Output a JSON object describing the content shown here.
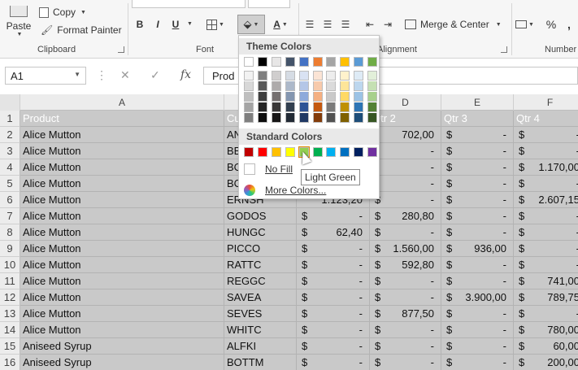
{
  "ribbon": {
    "clipboard": {
      "paste_label": "Paste",
      "copy_label": "Copy",
      "format_painter_label": "Format Painter",
      "group_label": "Clipboard"
    },
    "font": {
      "bold": "B",
      "italic": "I",
      "underline": "U",
      "group_label": "Font",
      "font_color_letter": "A"
    },
    "alignment": {
      "merge_label": "Merge & Center",
      "group_label": "Alignment"
    },
    "number": {
      "percent": "%",
      "comma": ",",
      "group_label": "Number"
    }
  },
  "formula_bar": {
    "name_box": "A1",
    "formula": "Prod",
    "fx": "fx"
  },
  "columns": [
    "A",
    "B",
    "C",
    "D",
    "E",
    "F"
  ],
  "rows": [
    {
      "n": "1",
      "a": "Product",
      "b": "Cu",
      "c": {
        "cur": "",
        "amt": ""
      },
      "d": "Qtr 2",
      "e": "Qtr 3",
      "f": "Qtr 4",
      "header": true
    },
    {
      "n": "2",
      "a": "Alice Mutton",
      "b": "AN",
      "c": {
        "cur": "",
        "amt": ""
      },
      "d": {
        "cur": "",
        "amt": "702,00"
      },
      "e": {
        "cur": "$",
        "amt": "-"
      },
      "f": {
        "cur": "$",
        "amt": "-"
      }
    },
    {
      "n": "3",
      "a": "Alice Mutton",
      "b": "BE",
      "c": {
        "cur": "",
        "amt": ""
      },
      "d": {
        "cur": "",
        "amt": "-"
      },
      "e": {
        "cur": "$",
        "amt": "-"
      },
      "f": {
        "cur": "$",
        "amt": "-"
      }
    },
    {
      "n": "4",
      "a": "Alice Mutton",
      "b": "BC",
      "c": {
        "cur": "",
        "amt": ""
      },
      "d": {
        "cur": "",
        "amt": "-"
      },
      "e": {
        "cur": "$",
        "amt": "-"
      },
      "f": {
        "cur": "$",
        "amt": "1.170,00"
      }
    },
    {
      "n": "5",
      "a": "Alice Mutton",
      "b": "BC",
      "c": {
        "cur": "",
        "amt": ""
      },
      "d": {
        "cur": "",
        "amt": "-"
      },
      "e": {
        "cur": "$",
        "amt": "-"
      },
      "f": {
        "cur": "$",
        "amt": "-"
      }
    },
    {
      "n": "6",
      "a": "Alice Mutton",
      "b": "ERNSH",
      "c": {
        "cur": "",
        "amt": "1.123,20"
      },
      "d": {
        "cur": "$",
        "amt": "-"
      },
      "e": {
        "cur": "$",
        "amt": "-"
      },
      "f": {
        "cur": "$",
        "amt": "2.607,15"
      }
    },
    {
      "n": "7",
      "a": "Alice Mutton",
      "b": "GODOS",
      "c": {
        "cur": "$",
        "amt": "-"
      },
      "d": {
        "cur": "$",
        "amt": "280,80"
      },
      "e": {
        "cur": "$",
        "amt": "-"
      },
      "f": {
        "cur": "$",
        "amt": "-"
      }
    },
    {
      "n": "8",
      "a": "Alice Mutton",
      "b": "HUNGC",
      "c": {
        "cur": "$",
        "amt": "62,40"
      },
      "d": {
        "cur": "$",
        "amt": "-"
      },
      "e": {
        "cur": "$",
        "amt": "-"
      },
      "f": {
        "cur": "$",
        "amt": "-"
      }
    },
    {
      "n": "9",
      "a": "Alice Mutton",
      "b": "PICCO",
      "c": {
        "cur": "$",
        "amt": "-"
      },
      "d": {
        "cur": "$",
        "amt": "1.560,00"
      },
      "e": {
        "cur": "$",
        "amt": "936,00"
      },
      "f": {
        "cur": "$",
        "amt": "-"
      }
    },
    {
      "n": "10",
      "a": "Alice Mutton",
      "b": "RATTC",
      "c": {
        "cur": "$",
        "amt": "-"
      },
      "d": {
        "cur": "$",
        "amt": "592,80"
      },
      "e": {
        "cur": "$",
        "amt": "-"
      },
      "f": {
        "cur": "$",
        "amt": "-"
      }
    },
    {
      "n": "11",
      "a": "Alice Mutton",
      "b": "REGGC",
      "c": {
        "cur": "$",
        "amt": "-"
      },
      "d": {
        "cur": "$",
        "amt": "-"
      },
      "e": {
        "cur": "$",
        "amt": "-"
      },
      "f": {
        "cur": "$",
        "amt": "741,00"
      }
    },
    {
      "n": "12",
      "a": "Alice Mutton",
      "b": "SAVEA",
      "c": {
        "cur": "$",
        "amt": "-"
      },
      "d": {
        "cur": "$",
        "amt": "-"
      },
      "e": {
        "cur": "$",
        "amt": "3.900,00"
      },
      "f": {
        "cur": "$",
        "amt": "789,75"
      }
    },
    {
      "n": "13",
      "a": "Alice Mutton",
      "b": "SEVES",
      "c": {
        "cur": "$",
        "amt": "-"
      },
      "d": {
        "cur": "$",
        "amt": "877,50"
      },
      "e": {
        "cur": "$",
        "amt": "-"
      },
      "f": {
        "cur": "$",
        "amt": "-"
      }
    },
    {
      "n": "14",
      "a": "Alice Mutton",
      "b": "WHITC",
      "c": {
        "cur": "$",
        "amt": "-"
      },
      "d": {
        "cur": "$",
        "amt": "-"
      },
      "e": {
        "cur": "$",
        "amt": "-"
      },
      "f": {
        "cur": "$",
        "amt": "780,00"
      }
    },
    {
      "n": "15",
      "a": "Aniseed Syrup",
      "b": "ALFKI",
      "c": {
        "cur": "$",
        "amt": "-"
      },
      "d": {
        "cur": "$",
        "amt": "-"
      },
      "e": {
        "cur": "$",
        "amt": "-"
      },
      "f": {
        "cur": "$",
        "amt": "60,00"
      }
    },
    {
      "n": "16",
      "a": "Aniseed Syrup",
      "b": "BOTTM",
      "c": {
        "cur": "$",
        "amt": "-"
      },
      "d": {
        "cur": "$",
        "amt": "-"
      },
      "e": {
        "cur": "$",
        "amt": "-"
      },
      "f": {
        "cur": "$",
        "amt": "200,00"
      }
    }
  ],
  "dropdown": {
    "theme_title": "Theme Colors",
    "standard_title": "Standard Colors",
    "no_fill": "No Fill",
    "more_colors": "More Colors...",
    "tooltip": "Light Green",
    "theme_top": [
      "#ffffff",
      "#000000",
      "#e7e6e6",
      "#44546a",
      "#4472c4",
      "#ed7d31",
      "#a5a5a5",
      "#ffc000",
      "#5b9bd5",
      "#70ad47"
    ],
    "theme_shades": [
      [
        "#f2f2f2",
        "#7f7f7f",
        "#d0cece",
        "#d6dce4",
        "#d9e2f3",
        "#fbe4d5",
        "#ededed",
        "#fff2cc",
        "#deebf6",
        "#e2efd9"
      ],
      [
        "#d8d8d8",
        "#595959",
        "#aeabab",
        "#adb9ca",
        "#b4c6e7",
        "#f7caac",
        "#dbdbdb",
        "#fee599",
        "#bdd7ee",
        "#c5e0b3"
      ],
      [
        "#bfbfbf",
        "#3f3f3f",
        "#757070",
        "#8496b0",
        "#8eaadb",
        "#f4b083",
        "#c9c9c9",
        "#ffd965",
        "#9cc3e5",
        "#a8d08d"
      ],
      [
        "#a5a5a5",
        "#262626",
        "#3a3838",
        "#323f4f",
        "#2f5496",
        "#c45911",
        "#7b7b7b",
        "#bf9000",
        "#2e75b5",
        "#538135"
      ],
      [
        "#7f7f7f",
        "#0d0d0d",
        "#171616",
        "#222a35",
        "#1f3864",
        "#833c0b",
        "#525252",
        "#7f6000",
        "#1e4e79",
        "#375623"
      ]
    ],
    "standard": [
      "#c00000",
      "#ff0000",
      "#ffc000",
      "#ffff00",
      "#92d050",
      "#00b050",
      "#00b0f0",
      "#0070c0",
      "#002060",
      "#7030a0"
    ]
  }
}
